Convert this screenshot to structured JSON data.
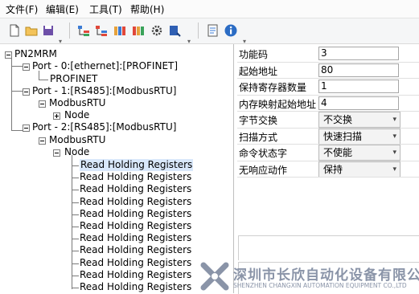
{
  "menu": [
    "文件(F)",
    "编辑(E)",
    "工具(T)",
    "帮助(H)"
  ],
  "toolbar": {
    "icons": [
      "new-file-icon",
      "open-folder-icon",
      "save-icon",
      "add-port-icon",
      "add-node-icon",
      "add-register-icon",
      "add-module-icon",
      "settings-icon",
      "export-icon",
      "properties-icon",
      "info-icon"
    ]
  },
  "tree": {
    "root": "PN2MRM",
    "port0": "Port - 0:[ethernet]:[PROFINET]",
    "profinet": "PROFINET",
    "port1": "Port - 1:[RS485]:[ModbusRTU]",
    "modbus1": "ModbusRTU",
    "node1": "Node",
    "port2": "Port - 2:[RS485]:[ModbusRTU]",
    "modbus2": "ModbusRTU",
    "node2": "Node",
    "registers": [
      "Read Holding Registers",
      "Read Holding Registers",
      "Read Holding Registers",
      "Read Holding Registers",
      "Read Holding Registers",
      "Read Holding Registers",
      "Read Holding Registers",
      "Read Holding Registers",
      "Read Holding Registers",
      "Read Holding Registers",
      "Read Holding Registers"
    ]
  },
  "props": [
    {
      "label": "功能码",
      "value": "3",
      "type": "input"
    },
    {
      "label": "起始地址",
      "value": "80",
      "type": "input"
    },
    {
      "label": "保持寄存器数量",
      "value": "1",
      "type": "input"
    },
    {
      "label": "内存映射起始地址",
      "value": "4",
      "type": "input"
    },
    {
      "label": "字节交换",
      "value": "不交换",
      "type": "select"
    },
    {
      "label": "扫描方式",
      "value": "快速扫描",
      "type": "select"
    },
    {
      "label": "命令状态字",
      "value": "不使能",
      "type": "select"
    },
    {
      "label": "无响应动作",
      "value": "保持",
      "type": "select"
    }
  ],
  "watermark": {
    "cn": "深圳市长欣自动化设备有限公司",
    "en": "SHENZHEN CHANGXIN AUTOMATION EQUIPMENT CO.,LTD"
  },
  "colors": {
    "selection": "#d9e8fb",
    "watermark": "#8a94a8"
  }
}
